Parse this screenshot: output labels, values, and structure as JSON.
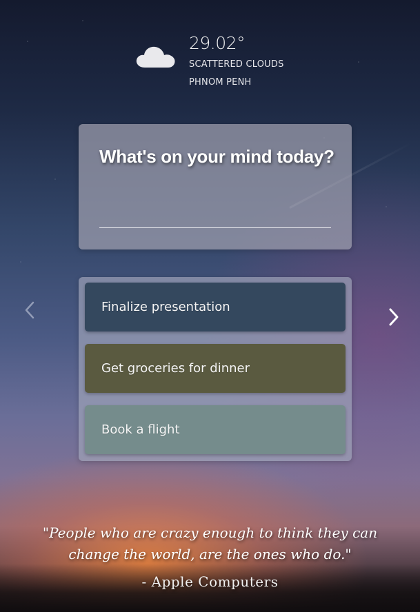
{
  "weather": {
    "icon": "cloud-icon",
    "temperature": "29.02°",
    "description": "SCATTERED CLOUDS",
    "city": "PHNOM PENH"
  },
  "focus": {
    "question": "What's on your mind today?",
    "input_value": "",
    "input_placeholder": ""
  },
  "todos": {
    "items": [
      {
        "label": "Finalize presentation",
        "color": "#34485e"
      },
      {
        "label": "Get groceries for dinner",
        "color": "#5a5a40"
      },
      {
        "label": "Book a flight",
        "color": "#758c8c"
      }
    ]
  },
  "navigation": {
    "prev_icon": "chevron-left-icon",
    "next_icon": "chevron-right-icon"
  },
  "quote": {
    "text": "\"People who are crazy enough to think they can change the world, are the ones who do.\"",
    "author": "- Apple Computers"
  }
}
